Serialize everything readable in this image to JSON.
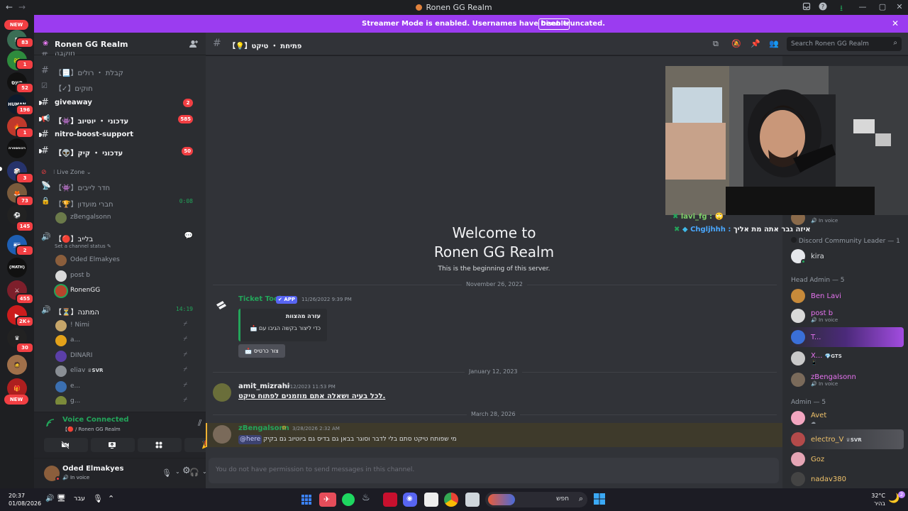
{
  "window": {
    "title": "Ronen GG Realm"
  },
  "rail": {
    "new_top": "NEW",
    "new_bottom": "NEW",
    "badges": [
      "83",
      "1",
      "52",
      "196",
      "1",
      "3",
      "73",
      "145",
      "2",
      "455",
      "2K+",
      "30"
    ],
    "text_icon_1": "רכוחספרה",
    "text_icon_2": "{MATH}",
    "text_icon_3": "HUMAN",
    "text_icon_4": "חעס"
  },
  "banner": {
    "text": "Streamer Mode is enabled. Usernames have been truncated.",
    "button": "Disable"
  },
  "guild": {
    "name": "Ronen GG Realm"
  },
  "channels": {
    "partial_top": "חוקבה",
    "kabalat": "קבלת ・ רולים",
    "chukim": "חוקים",
    "giveaway": "giveaway",
    "giveaway_count": "2",
    "youtube": "עדכוני ・ יוטיוב",
    "youtube_count": "585",
    "nitro": "nitro-boost-support",
    "kick": "עדכוני ・ קיק",
    "kick_count": "50",
    "category_live": "Live Zone",
    "live_room": "חדר לייבים",
    "club": "חברי מועדון",
    "club_timer": "0:08",
    "club_user": "zBengalsonn",
    "baliev": "בלייב",
    "channel_status": "Set a channel status",
    "baliev_users": [
      "Oded Elmakyes",
      "post b",
      "RonenGG"
    ],
    "waiting": "המתנה",
    "waiting_timer": "14:19",
    "waiting_users": [
      "! Nimi",
      "a...",
      "DINARI",
      "eliav",
      "e...",
      "g..."
    ],
    "eliav_tag": "SVR"
  },
  "voice_panel": {
    "status": "Voice Connected",
    "location": "🔴 / Ronen GG Realm",
    "location_prefix": "【",
    "location_channel": "בלייב 】"
  },
  "user_panel": {
    "name": "Oded Elmakyes",
    "status": "In voice"
  },
  "chat": {
    "channel_name": "פתיחת ・ טיקט",
    "search_placeholder": "Search Ronen GG Realm",
    "welcome_1": "Welcome to",
    "welcome_2": "Ronen GG Realm",
    "beginning": "This is the beginning of this server.",
    "dates": [
      "November 26, 2022",
      "January 12, 2023",
      "March 28, 2026"
    ],
    "messages": [
      {
        "author": "Ticket Tool",
        "tag": "APP",
        "time": "11/26/2022 9:39 PM",
        "embed_title": "עזרה מהצוות",
        "embed_body": "כדי ליצור בקשה הגיבו עם",
        "button": "צור כרטיס"
      },
      {
        "author": "amit_mizrahi",
        "time": "1/12/2023 11:53 PM",
        "text": "לכל בעיה ושאלה אתם מוזמנים לפתוח טיקט."
      },
      {
        "author": "zBengalsonn",
        "time": "3/28/2026 2:32 AM",
        "text": "מי שפותח טיקט סתם בלי לדבר וסוגר בבאן גם בדיס גם ביוטיוב גם בקיק",
        "mention": "@here"
      }
    ],
    "no_permission": "You do not have permission to send messages in this channel."
  },
  "overlay": {
    "line1_user": "lavi_fg :",
    "line2_user": "Chgljhhh :",
    "line2_text": "איזה גבר אתה מת אליך"
  },
  "members": {
    "top_status": "In voice",
    "cat_leader": "Discord Community Leader — 1",
    "leader": "kira",
    "cat_head": "Head Admin — 5",
    "head": [
      {
        "name": "Ben Lavi",
        "status": ""
      },
      {
        "name": "post b",
        "status": "In voice"
      },
      {
        "name": "T...",
        "status": ""
      },
      {
        "name": "X...",
        "status": "",
        "tag": "GTS"
      },
      {
        "name": "zBengalsonn",
        "status": "In voice"
      }
    ],
    "cat_admin": "Admin — 5",
    "admin": [
      {
        "name": "Avet"
      },
      {
        "name": "electro_V",
        "tag": "SVR"
      },
      {
        "name": "Goz"
      },
      {
        "name": "nadav380"
      }
    ]
  },
  "taskbar": {
    "time": "20:37",
    "date": "01/08/2026",
    "lang": "עבר",
    "search": "חפש",
    "weather_temp": "32°C",
    "weather_desc": "בהיר",
    "notif": "2"
  },
  "colors": {
    "banner": "#9b3cf0",
    "accent": "#5865f2",
    "online": "#23a55a",
    "badge": "#f23f43"
  }
}
